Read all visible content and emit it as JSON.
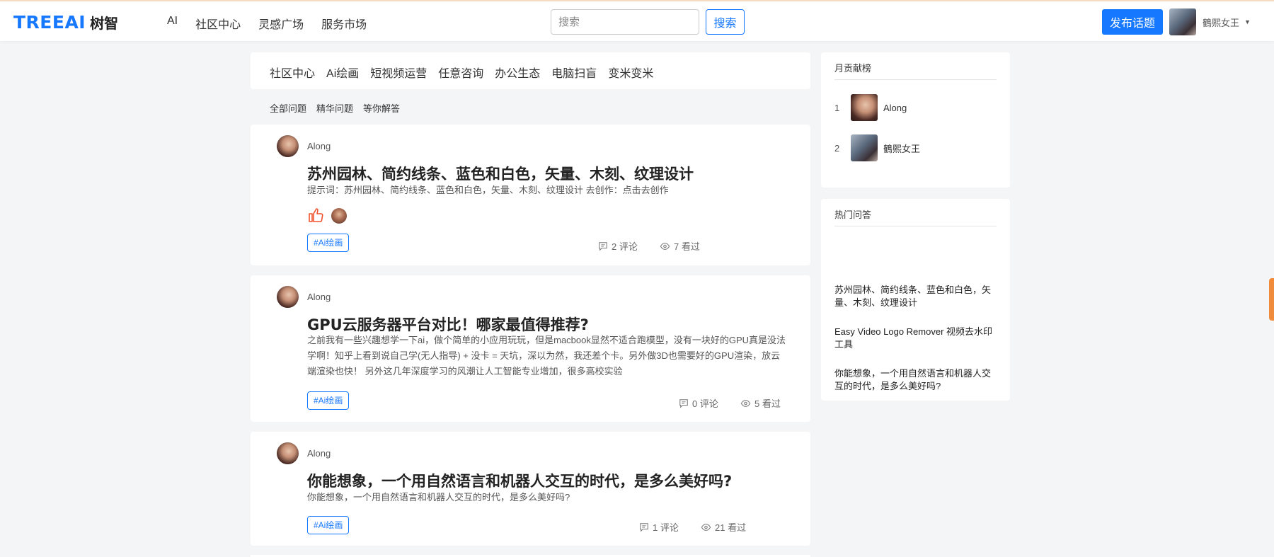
{
  "header": {
    "logo_en": "TREEAI",
    "logo_cn": "树智",
    "nav": [
      "AI",
      "社区中心",
      "灵感广场",
      "服务市场"
    ],
    "search_placeholder": "搜索",
    "search_button": "搜索",
    "post_button": "发布话题",
    "user_name": "鶴熙女王"
  },
  "categories": [
    "社区中心",
    "Ai绘画",
    "短视频运营",
    "任意咨询",
    "办公生态",
    "电脑扫盲",
    "变米变米"
  ],
  "subtabs": [
    "全部问题",
    "精华问题",
    "等你解答"
  ],
  "posts": [
    {
      "author": "Along",
      "title": "苏州园林、简约线条、蓝色和白色，矢量、木刻、纹理设计",
      "excerpt": "提示词：苏州园林、简约线条、蓝色和白色，矢量、木刻、纹理设计 去创作：点击去创作",
      "tag": "#Ai绘画",
      "comments": "2 评论",
      "views": "7 看过"
    },
    {
      "author": "Along",
      "title": "GPU云服务器平台对比！哪家最值得推荐?",
      "excerpt": "之前我有一些兴趣想学一下ai，做个简单的小应用玩玩，但是macbook显然不适合跑模型，没有一块好的GPU真是没法学啊！知乎上看到说自己学(无人指导) + 没卡 = 天坑，深以为然，我还差个卡。另外做3D也需要好的GPU渲染，放云端渲染也快！ 另外这几年深度学习的风潮让人工智能专业增加，很多高校实验",
      "tag": "#Ai绘画",
      "comments": "0 评论",
      "views": "5 看过"
    },
    {
      "author": "Along",
      "title": "你能想象，一个用自然语言和机器人交互的时代，是多么美好吗?",
      "excerpt": "你能想象，一个用自然语言和机器人交互的时代，是多么美好吗?",
      "tag": "#Ai绘画",
      "comments": "1 评论",
      "views": "21 看过"
    }
  ],
  "sidebar": {
    "monthly_title": "月贡献榜",
    "ranks": [
      {
        "num": "1",
        "name": "Along"
      },
      {
        "num": "2",
        "name": "鶴熙女王"
      }
    ],
    "hot_title": "热门问答",
    "hot_items": [
      "苏州园林、简约线条、蓝色和白色，矢量、木刻、纹理设计",
      "Easy Video Logo Remover 视频去水印工具",
      "你能想象，一个用自然语言和机器人交互的时代，是多么美好吗?"
    ]
  },
  "colors": {
    "accent": "#1677ff",
    "like": "#f0512d",
    "scrollbar": "#f08c3c"
  }
}
